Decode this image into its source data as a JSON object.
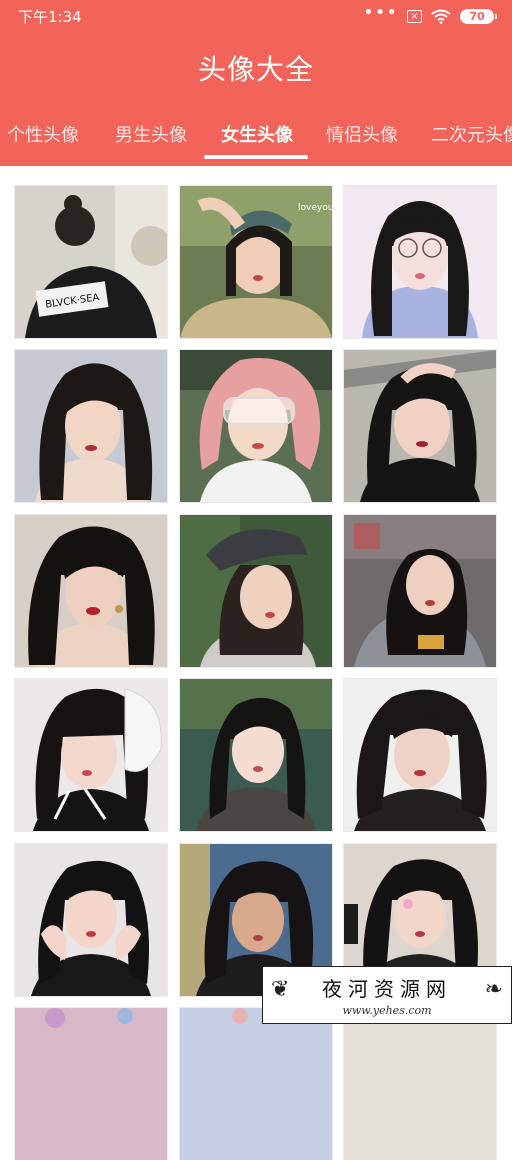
{
  "status_bar": {
    "time": "下午1:34",
    "dots": "•••",
    "x_box": "×",
    "battery": "70"
  },
  "header": {
    "title": "头像大全"
  },
  "tabs": [
    {
      "label": "个性头像",
      "active": false
    },
    {
      "label": "男生头像",
      "active": false
    },
    {
      "label": "女生头像",
      "active": true
    },
    {
      "label": "情侣头像",
      "active": false
    },
    {
      "label": "二次元头像",
      "active": false
    }
  ],
  "photo_captions": {
    "shirt_text": "BLVCK·SEA",
    "cap_text": "loveyou"
  },
  "watermark": {
    "title": "夜河资源网",
    "url": "www.yehes.com"
  },
  "colors": {
    "header": "#f2645a",
    "tab_active": "#ffffff"
  }
}
